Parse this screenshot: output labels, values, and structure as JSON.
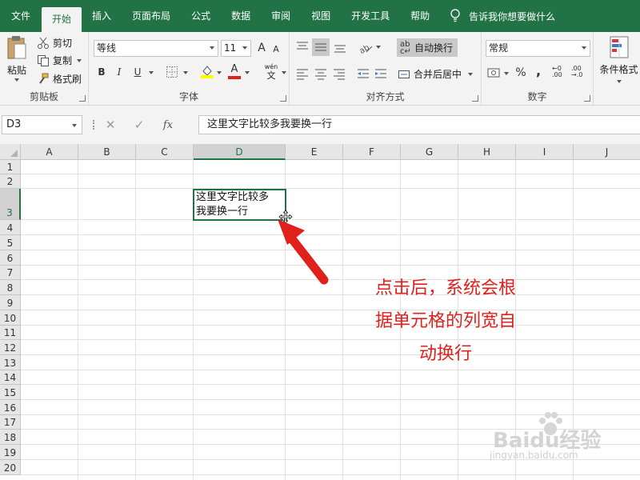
{
  "ribbon_tabs": [
    "文件",
    "开始",
    "插入",
    "页面布局",
    "公式",
    "数据",
    "审阅",
    "视图",
    "开发工具",
    "帮助"
  ],
  "tell_me": "告诉我你想要做什么",
  "clipboard": {
    "paste": "粘贴",
    "cut": "剪切",
    "copy": "复制",
    "format_painter": "格式刷",
    "label": "剪贴板"
  },
  "font": {
    "name": "等线",
    "size": "11",
    "label": "字体",
    "grow": "A",
    "shrink": "A",
    "bold": "B",
    "italic": "I",
    "underline": "U",
    "wen": "wén"
  },
  "alignment": {
    "wrap_text": "自动换行",
    "merge_center": "合并后居中",
    "label": "对齐方式",
    "ab": "ab"
  },
  "number": {
    "format": "常规",
    "label": "数字",
    "percent": "%"
  },
  "styles": {
    "conditional_format": "条件格式"
  },
  "formula_bar": {
    "name_box": "D3",
    "cancel": "✕",
    "enter": "✓",
    "fx": "fx",
    "content": "这里文字比较多我要换一行"
  },
  "columns": [
    "A",
    "B",
    "C",
    "D",
    "E",
    "F",
    "G",
    "H",
    "I",
    "J"
  ],
  "rows": [
    "1",
    "2",
    "3",
    "4",
    "5",
    "6",
    "7",
    "8",
    "9",
    "10",
    "11",
    "12",
    "13",
    "14",
    "15",
    "16",
    "17",
    "18",
    "19",
    "20"
  ],
  "cells": {
    "D3_line1": "这里文字比较多",
    "D3_line2": "我要换一行"
  },
  "annotation": {
    "line1": "点击后，系统会根",
    "line2": "据单元格的列宽自",
    "line3": "动换行"
  },
  "watermark": {
    "brand": "Baidu经验",
    "url": "jingyan.baidu.com"
  },
  "colors": {
    "accent": "#217346",
    "annotation": "#e0201b",
    "active_header": "#d2d2d2"
  }
}
